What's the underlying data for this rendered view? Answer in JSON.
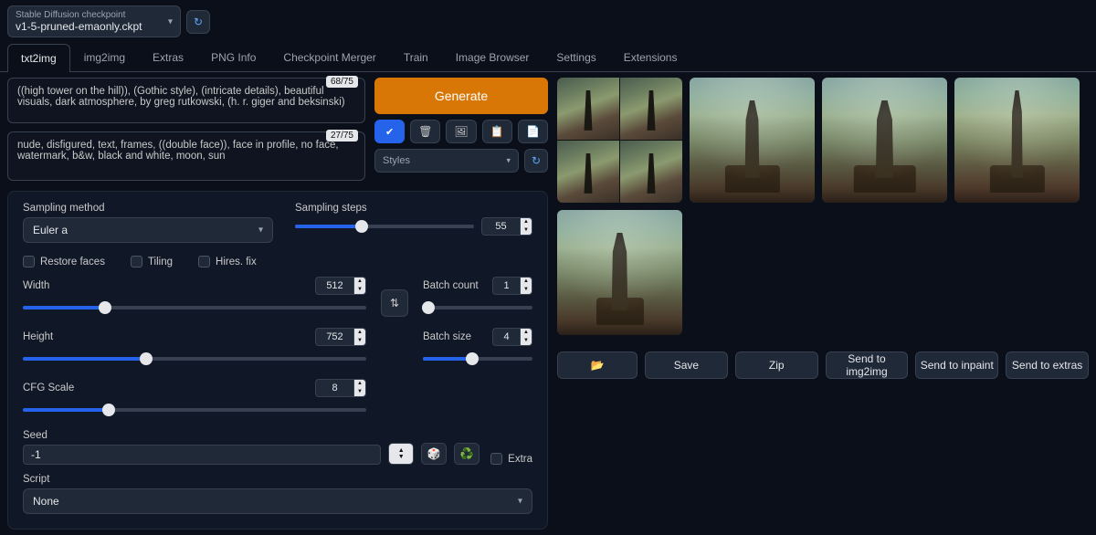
{
  "checkpoint": {
    "label": "Stable Diffusion checkpoint",
    "value": "v1-5-pruned-emaonly.ckpt"
  },
  "tabs": [
    "txt2img",
    "img2img",
    "Extras",
    "PNG Info",
    "Checkpoint Merger",
    "Train",
    "Image Browser",
    "Settings",
    "Extensions"
  ],
  "active_tab": "txt2img",
  "prompt": {
    "positive": "((high tower on the hill)), (Gothic style), (intricate details), beautiful visuals, dark atmosphere, by greg rutkowski, (h. r. giger and beksinski)",
    "negative": "nude, disfigured, text, frames, ((double face)), face in profile, no face, watermark, b&w, black and white, moon, sun",
    "pos_tokens": "68/75",
    "neg_tokens": "27/75"
  },
  "generate_label": "Generate",
  "mini_icons": {
    "check": "✔",
    "trash": "🗑",
    "img": "🖼",
    "paste": "📋",
    "read": "📄"
  },
  "styles_label": "Styles",
  "sampling": {
    "method_label": "Sampling method",
    "method_value": "Euler a",
    "steps_label": "Sampling steps",
    "steps_value": "55",
    "steps_fill_pct": 37
  },
  "checks": {
    "restore": "Restore faces",
    "tiling": "Tiling",
    "hires": "Hires. fix"
  },
  "dims": {
    "width_label": "Width",
    "width_value": "512",
    "width_fill_pct": 24,
    "height_label": "Height",
    "height_value": "752",
    "height_fill_pct": 36
  },
  "batch": {
    "count_label": "Batch count",
    "count_value": "1",
    "count_fill_pct": 5,
    "size_label": "Batch size",
    "size_value": "4",
    "size_fill_pct": 45
  },
  "cfg": {
    "label": "CFG Scale",
    "value": "8",
    "fill_pct": 25
  },
  "seed": {
    "label": "Seed",
    "value": "-1",
    "extra_label": "Extra"
  },
  "script": {
    "label": "Script",
    "value": "None"
  },
  "actions": {
    "folder": "📂",
    "save": "Save",
    "zip": "Zip",
    "img2img": "Send to img2img",
    "inpaint": "Send to inpaint",
    "extras": "Send to extras"
  }
}
